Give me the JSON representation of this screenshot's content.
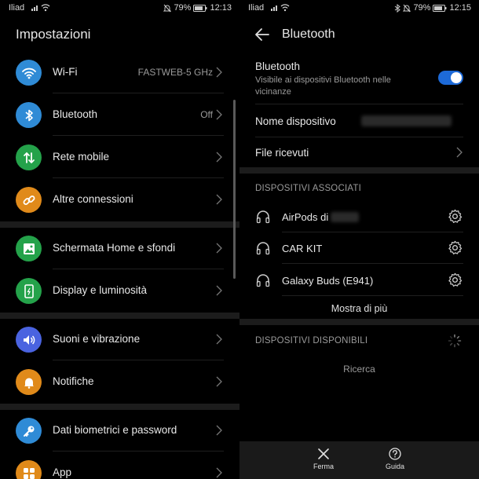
{
  "left_screen": {
    "status": {
      "carrier": "Iliad",
      "battery": "79%",
      "time": "12:13"
    },
    "title": "Impostazioni",
    "items": [
      {
        "label": "Wi-Fi",
        "value": "FASTWEB-5 GHz",
        "icon": "wifi-icon",
        "color": "#2f8bd6"
      },
      {
        "label": "Bluetooth",
        "value": "Off",
        "icon": "bluetooth-icon",
        "color": "#2f8bd6"
      },
      {
        "label": "Rete mobile",
        "value": "",
        "icon": "mobile-network-icon",
        "color": "#24a24a"
      },
      {
        "label": "Altre connessioni",
        "value": "",
        "icon": "link-icon",
        "color": "#e08a1a"
      },
      {
        "label": "Schermata Home e sfondi",
        "value": "",
        "icon": "image-icon",
        "color": "#24a24a"
      },
      {
        "label": "Display e luminosità",
        "value": "",
        "icon": "display-icon",
        "color": "#24a24a"
      },
      {
        "label": "Suoni e vibrazione",
        "value": "",
        "icon": "speaker-icon",
        "color": "#4a63e0"
      },
      {
        "label": "Notifiche",
        "value": "",
        "icon": "bell-icon",
        "color": "#e08a1a"
      },
      {
        "label": "Dati biometrici e password",
        "value": "",
        "icon": "key-icon",
        "color": "#2f8bd6"
      },
      {
        "label": "App",
        "value": "",
        "icon": "apps-icon",
        "color": "#e08a1a"
      }
    ]
  },
  "right_screen": {
    "status": {
      "carrier": "Iliad",
      "battery": "79%",
      "time": "12:15"
    },
    "title": "Bluetooth",
    "bluetooth_toggle": {
      "label": "Bluetooth",
      "subtitle": "Visibile ai dispositivi Bluetooth nelle vicinanze",
      "on": true
    },
    "device_name_label": "Nome dispositivo",
    "received_files_label": "File ricevuti",
    "paired_header": "DISPOSITIVI ASSOCIATI",
    "paired_devices": [
      {
        "name": "AirPods di"
      },
      {
        "name": "CAR KIT"
      },
      {
        "name": "Galaxy Buds (E941)"
      }
    ],
    "show_more": "Mostra di più",
    "available_header": "DISPOSITIVI DISPONIBILI",
    "searching": "Ricerca",
    "bottom": {
      "stop": "Ferma",
      "help": "Guida"
    }
  }
}
